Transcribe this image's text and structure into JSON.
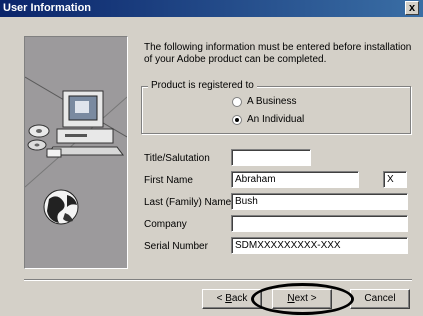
{
  "window": {
    "title": "User Information",
    "close_label": "x"
  },
  "intro_text": "The following information must be entered before installation of your Adobe product can be completed.",
  "registration": {
    "group_label": "Product is registered to",
    "options": [
      {
        "label": "A Business",
        "selected": false
      },
      {
        "label": "An Individual",
        "selected": true
      }
    ]
  },
  "fields": {
    "title": {
      "label": "Title/Salutation",
      "value": ""
    },
    "first_name": {
      "label": "First Name",
      "value": "Abraham"
    },
    "middle_initial": {
      "value": "X"
    },
    "last_name": {
      "label": "Last (Family) Name",
      "value": "Bush"
    },
    "company": {
      "label": "Company",
      "value": ""
    },
    "serial": {
      "label": "Serial Number",
      "value": "SDMXXXXXXXXX-XXX"
    }
  },
  "buttons": {
    "back": {
      "pre": "< ",
      "accel": "B",
      "rest": "ack"
    },
    "next": {
      "accel": "N",
      "rest": "ext >"
    },
    "cancel": "Cancel"
  },
  "art_icons": [
    "computer-icon",
    "cd-disc-icon",
    "globe-icon"
  ],
  "colors": {
    "titlebar_start": "#0a246a",
    "titlebar_end": "#3a6ea5",
    "dialog_bg": "#d4d0c8"
  }
}
